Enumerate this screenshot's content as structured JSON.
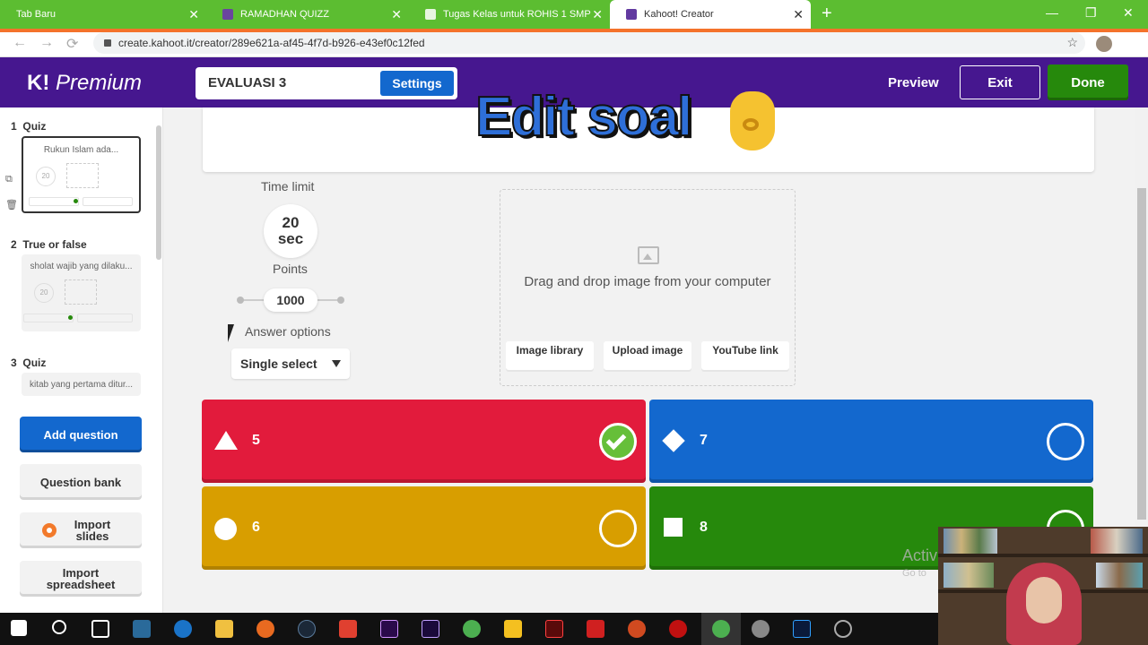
{
  "browser": {
    "tabs": [
      {
        "label": "Tab Baru"
      },
      {
        "label": "RAMADHAN QUIZZ"
      },
      {
        "label": "Tugas Kelas untuk ROHIS 1 SMP"
      },
      {
        "label": "Kahoot! Creator"
      }
    ],
    "url": "create.kahoot.it/creator/289e621a-af45-4f7d-b926-e43ef0c12fed"
  },
  "header": {
    "logo": "K!",
    "logo_suffix": "Premium",
    "title": "EVALUASI 3",
    "settings": "Settings",
    "preview": "Preview",
    "exit": "Exit",
    "done": "Done"
  },
  "sidebar": {
    "questions": [
      {
        "number": "1",
        "type": "Quiz",
        "text": "Rukun Islam ada...",
        "time": "20"
      },
      {
        "number": "2",
        "type": "True or false",
        "text": "sholat wajib yang dilaku...",
        "time": "20"
      },
      {
        "number": "3",
        "type": "Quiz",
        "text": "kitab yang pertama ditur..."
      }
    ],
    "add_question": "Add question",
    "question_bank": "Question bank",
    "import_slides": "Import slides",
    "import_spreadsheet": "Import spreadsheet"
  },
  "overlay_text": "Edit soal",
  "editor": {
    "time_limit_label": "Time limit",
    "time_limit_value": "20",
    "time_limit_unit": "sec",
    "points_label": "Points",
    "points_value": "1000",
    "answer_options_label": "Answer options",
    "answer_options_value": "Single select",
    "media_text": "Drag and drop image from your computer",
    "media_buttons": [
      "Image library",
      "Upload image",
      "YouTube link"
    ],
    "answers": [
      {
        "text": "5",
        "color": "#e21b3c",
        "shape": "triangle-icon",
        "correct": true
      },
      {
        "text": "7",
        "color": "#1368ce",
        "shape": "diamond-icon",
        "correct": false
      },
      {
        "text": "6",
        "color": "#d89e00",
        "shape": "circle-icon",
        "correct": false
      },
      {
        "text": "8",
        "color": "#26890c",
        "shape": "square-icon",
        "correct": false
      }
    ]
  },
  "watermark": {
    "line1": "Activ",
    "line2": "Go to"
  }
}
